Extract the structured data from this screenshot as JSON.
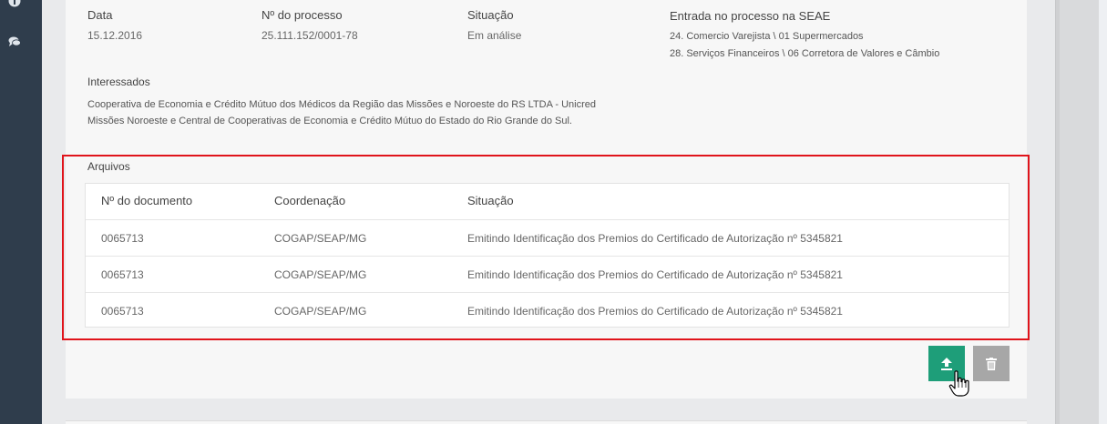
{
  "sidebar": {
    "icons": [
      "info-icon",
      "chat-icon"
    ]
  },
  "details": {
    "data_label": "Data",
    "data_value": "15.12.2016",
    "processo_label": "Nº do processo",
    "processo_value": "25.111.152/0001-78",
    "situacao_label": "Situação",
    "situacao_value": "Em análise",
    "entrada_label": "Entrada no processo na SEAE",
    "entrada_values": [
      "24. Comercio Varejista \\ 01 Supermercados",
      "28. Serviços Financeiros \\ 06 Corretora de Valores e Câmbio"
    ]
  },
  "interessados": {
    "label": "Interessados",
    "text": "Cooperativa de Economia e Crédito Mútuo dos Médicos da Região das Missões e Noroeste do RS LTDA - Unicred Missões Noroeste e Central de Cooperativas de Economia e Crédito Mútuo do Estado do Rio Grande do Sul."
  },
  "arquivos": {
    "label": "Arquivos",
    "columns": [
      "Nº do documento",
      "Coordenação",
      "Situação"
    ],
    "rows": [
      [
        "0065713",
        "COGAP/SEAP/MG",
        "Emitindo Identificação dos Premios do Certificado de Autorização nº 5345821"
      ],
      [
        "0065713",
        "COGAP/SEAP/MG",
        "Emitindo Identificação dos Premios do Certificado de Autorização nº 5345821"
      ],
      [
        "0065713",
        "COGAP/SEAP/MG",
        "Emitindo Identificação dos Premios do Certificado de Autorização nº 5345821"
      ]
    ]
  },
  "actions": {
    "upload_icon": "upload-icon",
    "delete_icon": "trash-icon"
  },
  "colors": {
    "upload_button": "#1e9e79",
    "delete_button": "#a7a7a7",
    "highlight_border": "#e0141b",
    "sidebar": "#2f3d4c"
  }
}
